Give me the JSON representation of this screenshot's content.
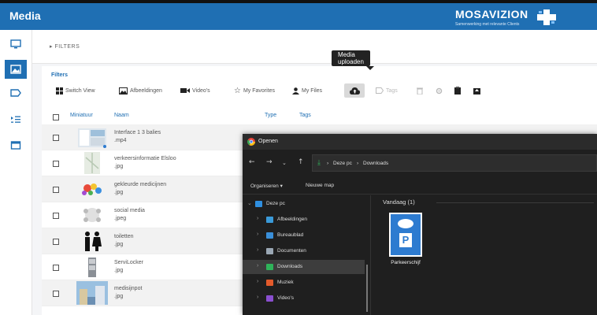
{
  "app": {
    "title": "Media"
  },
  "logo": {
    "name": "MOSAVIZION",
    "tagline": "Samenwerking met relevante Clients"
  },
  "sidebar": {
    "items": [
      {
        "icon": "monitor-icon",
        "active": false
      },
      {
        "icon": "image-icon",
        "active": true
      },
      {
        "icon": "tag-icon",
        "active": false
      },
      {
        "icon": "list-icon",
        "active": false
      },
      {
        "icon": "calendar-icon",
        "active": false
      }
    ]
  },
  "filters": {
    "toggle_label": "FILTERS",
    "panel_label": "Filters"
  },
  "toolbar": {
    "tooltip": "Media uploaden",
    "switch_view": "Switch View",
    "images": "Afbeeldingen",
    "videos": "Video's",
    "favorites": "My Favorites",
    "files": "My Files",
    "tags": "Tags"
  },
  "table": {
    "headers": {
      "thumb": "Miniatuur",
      "name": "Naam",
      "type": "Type",
      "tags": "Tags"
    },
    "rows": [
      {
        "name": "Interface 1 3 balies",
        "ext": ".mp4"
      },
      {
        "name": "verkeersinformatie Elsloo",
        "ext": ".jpg"
      },
      {
        "name": "gekleurde medicijnen",
        "ext": ".jpg"
      },
      {
        "name": "social media",
        "ext": ".jpeg"
      },
      {
        "name": "toiletten",
        "ext": ".jpg"
      },
      {
        "name": "ServiLocker",
        "ext": ".jpg"
      },
      {
        "name": "medisijnpot",
        "ext": ".jpg"
      }
    ]
  },
  "dialog": {
    "title": "Openen",
    "address": [
      "Deze pc",
      "Downloads"
    ],
    "organize": "Organiseren",
    "new_folder": "Nieuwe map",
    "nav": [
      {
        "label": "Deze pc",
        "color": "#2f8fe0",
        "selected": false
      },
      {
        "label": "Afbeeldingen",
        "color": "#3a9ad9",
        "selected": false
      },
      {
        "label": "Bureaublad",
        "color": "#3a8fd9",
        "selected": false
      },
      {
        "label": "Documenten",
        "color": "#9aa7b4",
        "selected": false
      },
      {
        "label": "Downloads",
        "color": "#2fb35a",
        "selected": true
      },
      {
        "label": "Muziek",
        "color": "#e35a2b",
        "selected": false
      },
      {
        "label": "Video's",
        "color": "#8a4fd0",
        "selected": false
      }
    ],
    "group": "Vandaag (1)",
    "file": {
      "name": "Parkeerschijf",
      "letter": "P"
    }
  }
}
